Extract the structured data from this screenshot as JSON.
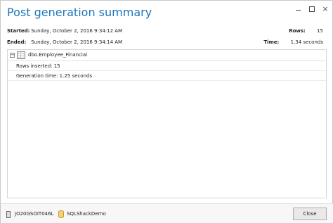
{
  "window": {
    "title": "Post generation summary",
    "controls": {
      "minimize_icon": "minimize-icon",
      "maximize_icon": "maximize-icon",
      "close_icon": "close-icon",
      "close_glyph": "×"
    }
  },
  "summary": {
    "started_label": "Started:",
    "started_value": "Sunday, October 2, 2016 9:34:12 AM",
    "ended_label": "Ended:",
    "ended_value": "Sunday, October 2, 2016 9:34:14 AM",
    "rows_label": "Rows:",
    "rows_value": "15",
    "time_label": "Time:",
    "time_value": "1.34 seconds"
  },
  "results": {
    "collapse_glyph": "−",
    "table_icon": "table-icon",
    "table_name": "dbo.Employee_Financial",
    "rows_inserted": "Rows inserted: 15",
    "generation_time": "Generation time: 1.25 seconds"
  },
  "footer": {
    "server_icon": "server-icon",
    "server_name": "JO20GSOIT046L",
    "database_icon": "database-icon",
    "database_name": "SQLShackDemo",
    "close_label": "Close"
  },
  "colors": {
    "title": "#1b75bb",
    "panel_border": "#d6d6d6",
    "footer_bg": "#f7f7f7"
  }
}
